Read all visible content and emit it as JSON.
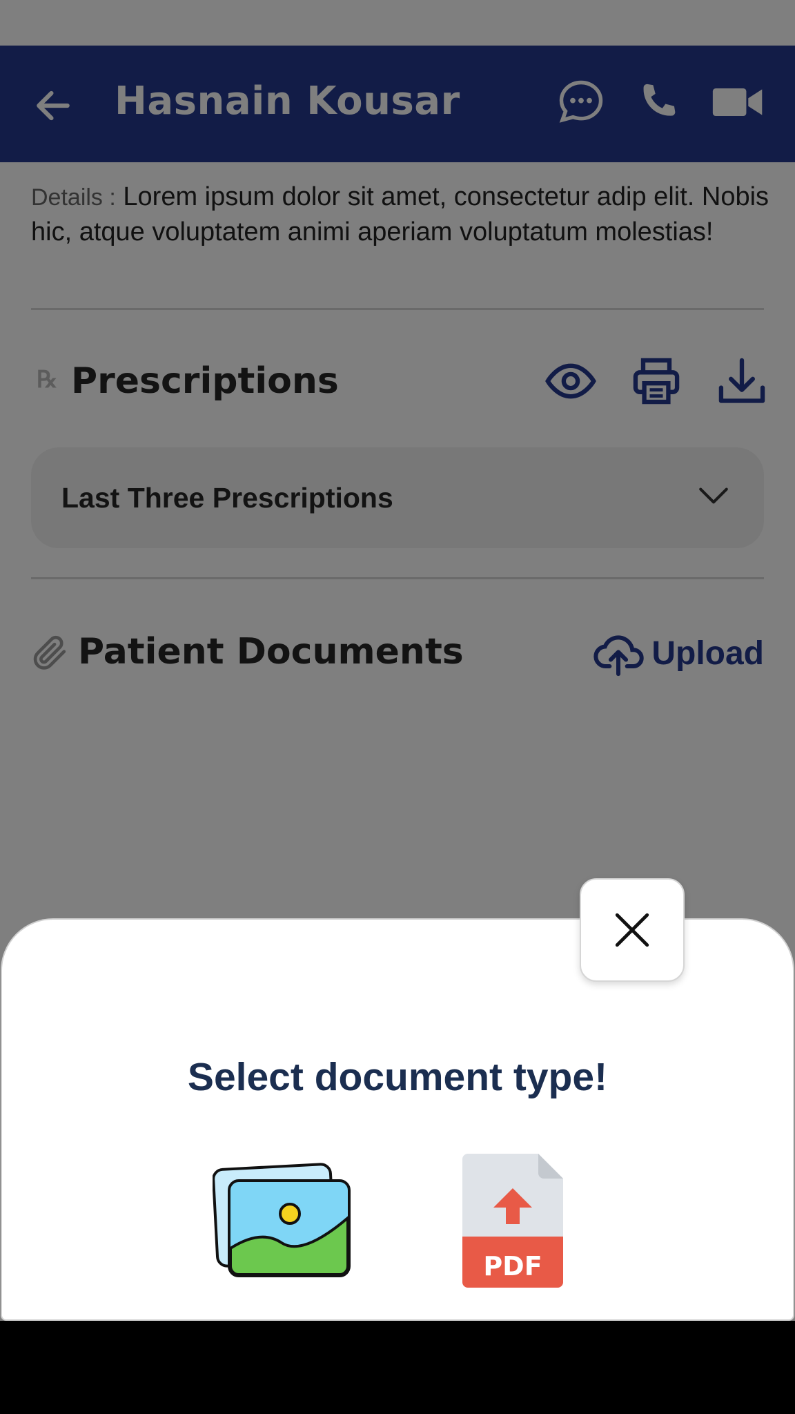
{
  "header": {
    "title": "Hasnain Kousar",
    "background_color": "#24388f",
    "icons": [
      "back-arrow-icon",
      "chat-icon",
      "phone-icon",
      "video-camera-icon"
    ]
  },
  "details": {
    "label": "Details :",
    "text": "Lorem ipsum dolor sit amet, consectetur adip elit. Nobis hic, atque voluptatem animi aperiam voluptatum molestias!"
  },
  "prescriptions": {
    "title": "Prescriptions",
    "rx_symbol": "℞",
    "actions": [
      "eye-icon",
      "print-icon",
      "download-icon"
    ],
    "accordion_label": "Last Three Prescriptions"
  },
  "documents": {
    "title": "Patient Documents",
    "upload_label": "Upload"
  },
  "sheet": {
    "title": "Select document type!",
    "options": [
      "image-gallery-icon",
      "pdf-upload-icon"
    ],
    "title_color": "#1b2e50"
  },
  "pdf_icon_text": "PDF"
}
